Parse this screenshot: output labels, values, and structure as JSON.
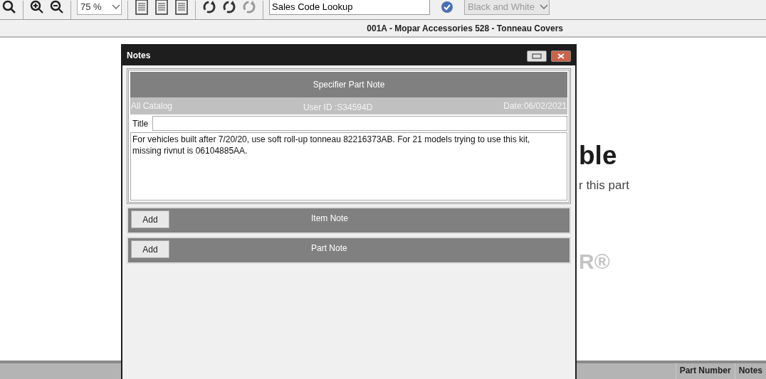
{
  "toolbar": {
    "zoom_select": {
      "value": "75 %"
    },
    "lookup_field": {
      "value": "Sales Code Lookup"
    },
    "color_select": {
      "value": "Black and White",
      "disabled": true
    }
  },
  "header": {
    "title": "001A - Mopar Accessories 528 - Tonneau Covers"
  },
  "content": {
    "heading": "ble",
    "subtext": "r this part",
    "logo_text": "R®"
  },
  "table": {
    "columns": [
      "Part Number",
      "Notes"
    ]
  },
  "dialog": {
    "title": "Notes",
    "specifier_note": {
      "heading": "Specifier Part Note",
      "catalog": "All Catalog",
      "user_id": "User ID :S34594D",
      "date": "Date:06/02/2021",
      "title_label": "Title",
      "body": "For vehicles built after 7/20/20, use soft roll-up tonneau 82216373AB.  For 21 models trying to use this kit, missing rivnut is 06104885AA."
    },
    "sections": [
      {
        "label": "Item Note",
        "button": "Add"
      },
      {
        "label": "Part Note",
        "button": "Add"
      }
    ]
  }
}
